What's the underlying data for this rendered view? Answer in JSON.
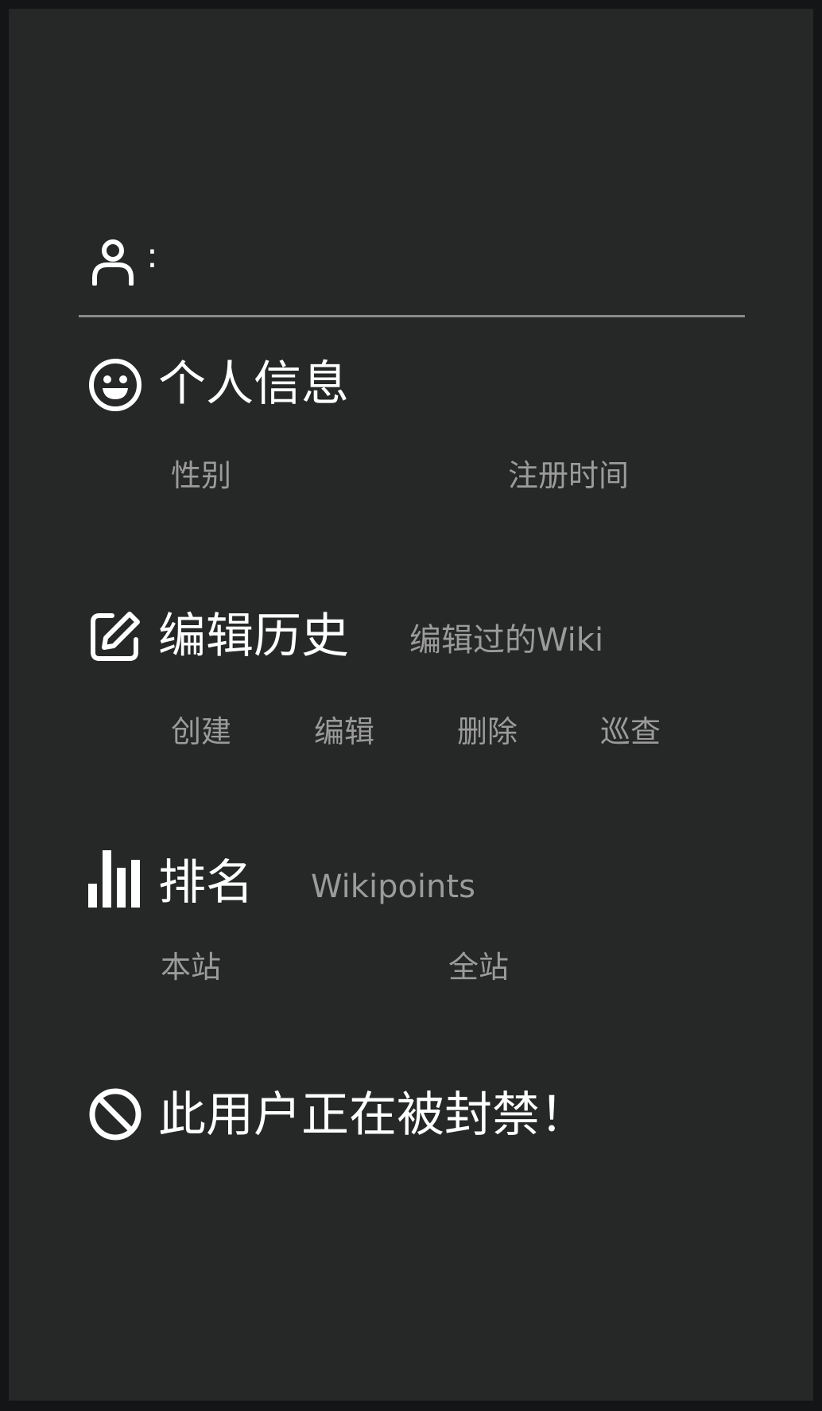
{
  "user": {
    "colon": ":",
    "icon": "user-icon"
  },
  "personal_info": {
    "icon": "smiley-icon",
    "title": "个人信息",
    "items": [
      "性别",
      "注册时间"
    ]
  },
  "edit_history": {
    "icon": "edit-icon",
    "title": "编辑历史",
    "subtitle": "编辑过的Wiki",
    "items": [
      "创建",
      "编辑",
      "删除",
      "巡查"
    ]
  },
  "ranking": {
    "icon": "bar-chart-icon",
    "title": "排名",
    "subtitle": "Wikipoints",
    "items": [
      "本站",
      "全站"
    ]
  },
  "ban_notice": {
    "icon": "ban-icon",
    "text": "此用户正在被封禁！"
  },
  "colors": {
    "background": "#262727",
    "frame": "#141517",
    "title_text": "#ffffff",
    "secondary_text": "#9b9b9b"
  }
}
